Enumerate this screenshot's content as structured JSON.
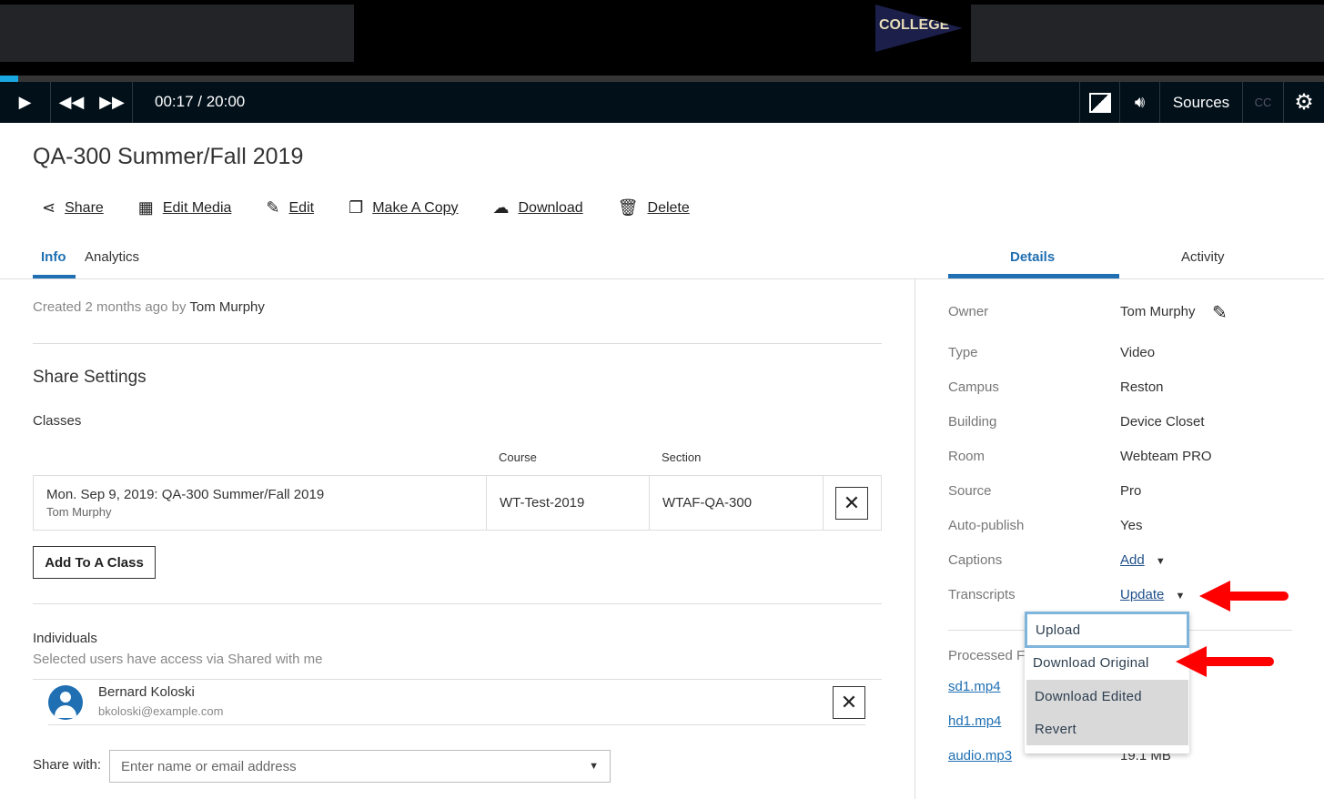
{
  "player": {
    "logo_text": "COLLEGE",
    "progress_fraction": 0.014,
    "time": "00:17 / 20:00",
    "sources_label": "Sources",
    "cc_label": "CC"
  },
  "media": {
    "title": "QA-300 Summer/Fall 2019"
  },
  "actions": [
    {
      "label": "Share",
      "icon": "share-icon"
    },
    {
      "label": "Edit Media",
      "icon": "film-icon"
    },
    {
      "label": "Edit",
      "icon": "pencil-icon"
    },
    {
      "label": "Make A Copy",
      "icon": "copy-icon"
    },
    {
      "label": "Download",
      "icon": "cloud-download-icon"
    },
    {
      "label": "Delete",
      "icon": "trash-icon"
    }
  ],
  "left_tabs": [
    {
      "label": "Info",
      "active": true
    },
    {
      "label": "Analytics",
      "active": false
    }
  ],
  "right_tabs": [
    {
      "label": "Details",
      "active": true
    },
    {
      "label": "Activity",
      "active": false
    }
  ],
  "info": {
    "created_prefix": "Created",
    "created_when": "2 months ago",
    "created_by_word": "by",
    "created_by": "Tom Murphy",
    "share_settings": "Share Settings",
    "classes_label": "Classes",
    "col_course": "Course",
    "col_section": "Section",
    "class_row": {
      "name": "Mon. Sep 9, 2019: QA-300 Summer/Fall 2019",
      "owner": "Tom Murphy",
      "course": "WT-Test-2019",
      "section": "WTAF-QA-300"
    },
    "add_class": "Add To A Class",
    "individuals_label": "Individuals",
    "individuals_sub": "Selected users have access via Shared with me",
    "user": {
      "name": "Bernard Koloski",
      "email": "bkoloski@example.com"
    },
    "share_with_label": "Share with:",
    "share_with_placeholder": "Enter name or email address"
  },
  "details": [
    {
      "k": "Owner",
      "v": "Tom Murphy"
    },
    {
      "k": "Type",
      "v": "Video"
    },
    {
      "k": "Campus",
      "v": "Reston"
    },
    {
      "k": "Building",
      "v": "Device Closet"
    },
    {
      "k": "Room",
      "v": "Webteam PRO"
    },
    {
      "k": "Source",
      "v": "Pro"
    },
    {
      "k": "Auto-publish",
      "v": "Yes"
    },
    {
      "k": "Captions",
      "v": "Add"
    },
    {
      "k": "Transcripts",
      "v": "Update"
    }
  ],
  "processed": {
    "label": "Processed F",
    "files": [
      {
        "name": "sd1.mp4"
      },
      {
        "name": "hd1.mp4"
      },
      {
        "name": "audio.mp3",
        "size": "19.1 MB"
      }
    ]
  },
  "transcripts_menu": [
    "Upload",
    "Download Original",
    "Download Edited",
    "Revert"
  ],
  "colors": {
    "accent": "#1f6fb2",
    "annotation_arrow": "#ff0000"
  }
}
